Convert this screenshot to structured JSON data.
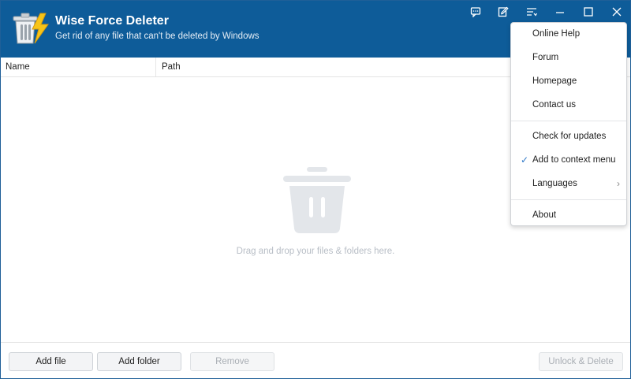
{
  "app": {
    "title": "Wise Force Deleter",
    "subtitle": "Get rid of any file that can't be deleted by Windows",
    "accent_color": "#0e5c99"
  },
  "titlebar_icons": [
    "feedback-icon",
    "edit-icon",
    "menu-icon",
    "minimize-icon",
    "maximize-icon",
    "close-icon"
  ],
  "table": {
    "columns": [
      "Name",
      "Path"
    ]
  },
  "drop_area": {
    "icon": "trash-icon",
    "hint": "Drag and drop your files & folders here."
  },
  "footer": {
    "add_file": "Add file",
    "add_folder": "Add folder",
    "remove": "Remove",
    "unlock_delete": "Unlock & Delete"
  },
  "menu": {
    "items": [
      {
        "label": "Online Help"
      },
      {
        "label": "Forum"
      },
      {
        "label": "Homepage"
      },
      {
        "label": "Contact us"
      },
      {
        "label": "Check for updates"
      },
      {
        "label": "Add to context menu",
        "checked": true
      },
      {
        "label": "Languages",
        "submenu": true
      },
      {
        "label": "About"
      }
    ]
  }
}
